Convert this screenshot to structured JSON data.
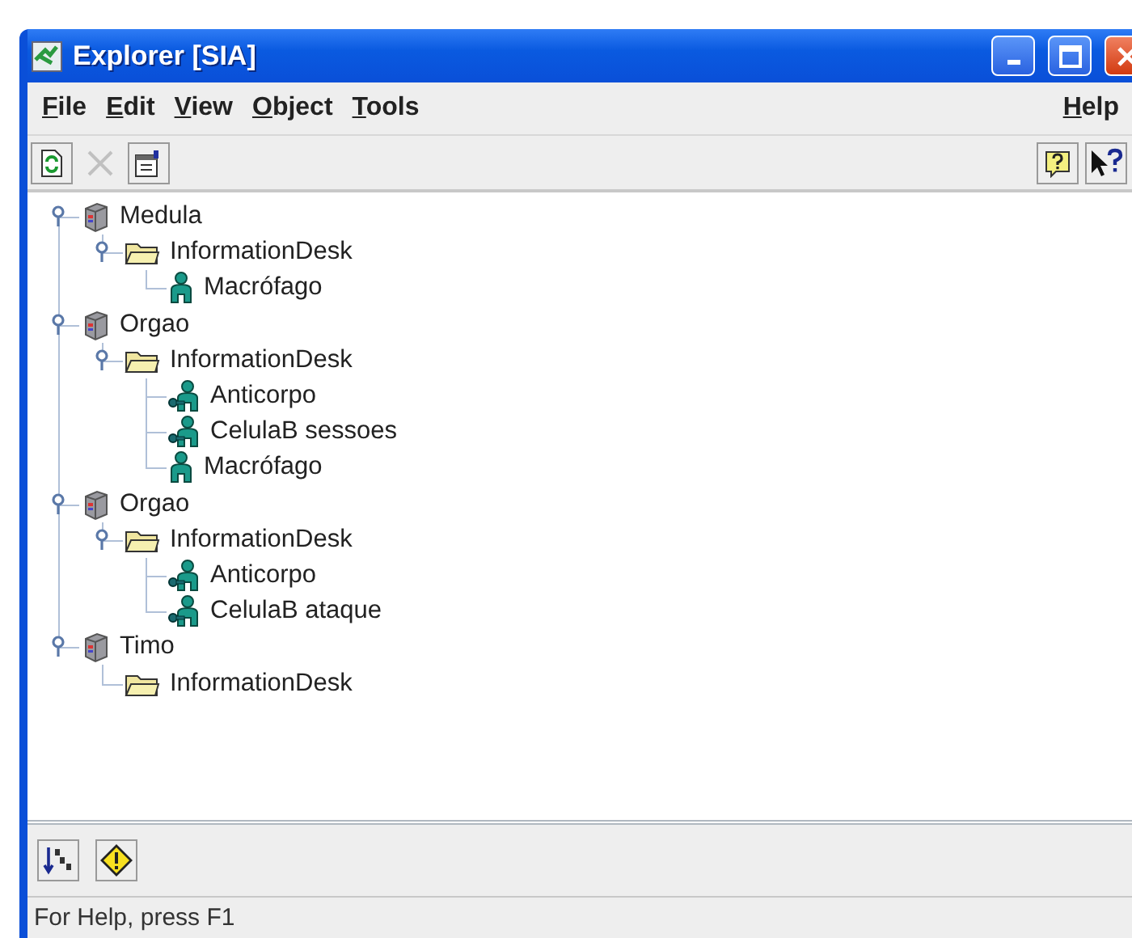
{
  "window": {
    "title": "Explorer [SIA]"
  },
  "menu": [
    {
      "label": "File"
    },
    {
      "label": "Edit"
    },
    {
      "label": "View"
    },
    {
      "label": "Object"
    },
    {
      "label": "Tools"
    }
  ],
  "menu_right": [
    {
      "label": "Help"
    }
  ],
  "toolbar": [
    {
      "kind": "refresh",
      "disabled": false
    },
    {
      "kind": "delete",
      "disabled": true
    },
    {
      "kind": "properties",
      "disabled": false
    }
  ],
  "toolbar_right": [
    {
      "kind": "help",
      "disabled": false
    },
    {
      "kind": "context-help",
      "disabled": false
    }
  ],
  "tree": [
    {
      "label": "Medula",
      "kind": "host",
      "expanded": true,
      "children": [
        {
          "label": "InformationDesk",
          "kind": "folder",
          "expanded": true,
          "children": [
            {
              "label": "Macrófago",
              "kind": "agent"
            }
          ]
        }
      ]
    },
    {
      "label": "Orgao",
      "kind": "host",
      "expanded": true,
      "children": [
        {
          "label": "InformationDesk",
          "kind": "folder",
          "expanded": true,
          "children": [
            {
              "label": "Anticorpo",
              "kind": "agent-linked"
            },
            {
              "label": "CelulaB sessoes",
              "kind": "agent-linked"
            },
            {
              "label": "Macrófago",
              "kind": "agent"
            }
          ]
        }
      ]
    },
    {
      "label": "Orgao",
      "kind": "host",
      "expanded": true,
      "children": [
        {
          "label": "InformationDesk",
          "kind": "folder",
          "expanded": true,
          "children": [
            {
              "label": "Anticorpo",
              "kind": "agent-linked"
            },
            {
              "label": "CelulaB ataque",
              "kind": "agent-linked"
            }
          ]
        }
      ]
    },
    {
      "label": "Timo",
      "kind": "host",
      "expanded": true,
      "children": [
        {
          "label": "InformationDesk",
          "kind": "folder"
        }
      ]
    }
  ],
  "bottom_toolbar": [
    {
      "kind": "sort"
    },
    {
      "kind": "warning"
    }
  ],
  "status_bar": "For Help, press F1"
}
